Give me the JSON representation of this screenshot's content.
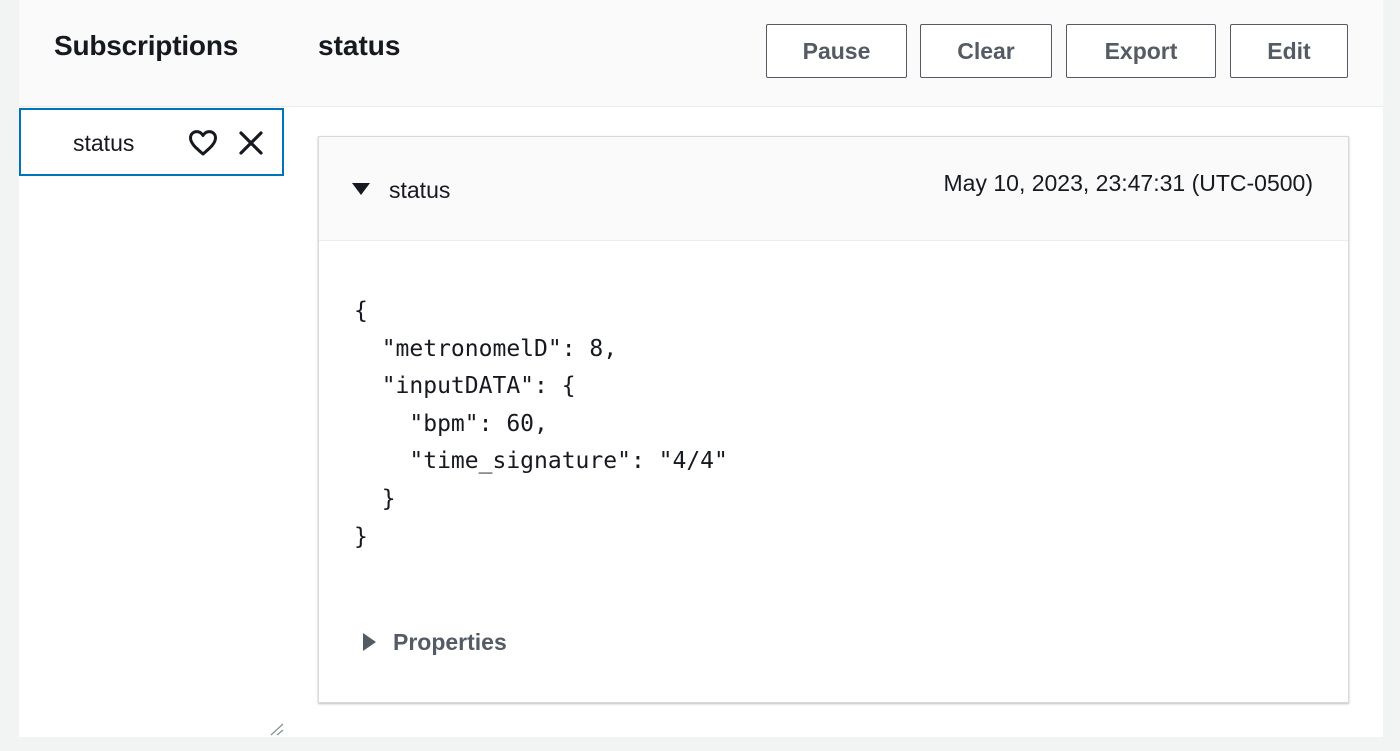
{
  "header": {
    "sidebar_title": "Subscriptions",
    "topic_title": "status",
    "buttons": {
      "pause": "Pause",
      "clear": "Clear",
      "export": "Export",
      "edit": "Edit"
    }
  },
  "sidebar": {
    "subscriptions": [
      {
        "label": "status",
        "icons": [
          "heart-icon",
          "close-icon"
        ],
        "selected": true
      }
    ]
  },
  "message": {
    "topic": "status",
    "timestamp": "May 10, 2023, 23:47:31 (UTC-0500)",
    "expanded": true,
    "payload": "{\n  \"metronomelD\": 8,\n  \"inputDATA\": {\n    \"bpm\": 60,\n    \"time_signature\": \"4/4\"\n  }\n}",
    "properties_label": "Properties",
    "properties_expanded": false
  },
  "colors": {
    "accent": "#0073bb",
    "text": "#16191f",
    "secondary_text": "#545b64",
    "background": "#f2f3f3"
  }
}
